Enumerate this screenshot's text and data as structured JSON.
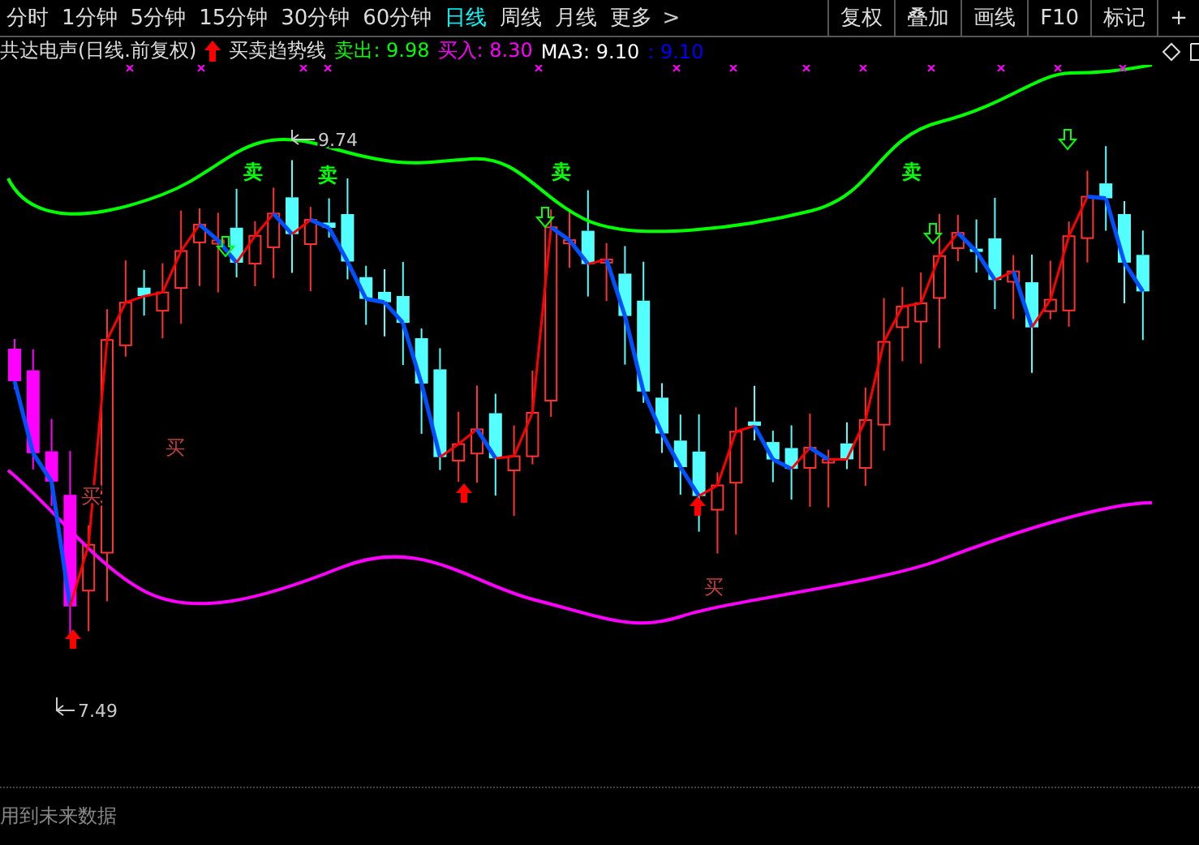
{
  "toolbar": {
    "periods": [
      {
        "label": "分时",
        "selected": false
      },
      {
        "label": "1分钟",
        "selected": false
      },
      {
        "label": "5分钟",
        "selected": false
      },
      {
        "label": "15分钟",
        "selected": false
      },
      {
        "label": "30分钟",
        "selected": false
      },
      {
        "label": "60分钟",
        "selected": false
      },
      {
        "label": "日线",
        "selected": true
      },
      {
        "label": "周线",
        "selected": false
      },
      {
        "label": "月线",
        "selected": false
      },
      {
        "label": "更多",
        "selected": false
      }
    ],
    "more_arrow": ">",
    "buttons": [
      "复权",
      "叠加",
      "画线",
      "F10",
      "标记",
      "+"
    ]
  },
  "legend": {
    "title": "共达电声(日线.前复权)",
    "indicator": "买卖趋势线",
    "items": [
      {
        "text": "卖出: 9.98",
        "color": "#00ff00"
      },
      {
        "text": "买入: 8.30",
        "color": "#ff00ff"
      },
      {
        "text": "MA3: 9.10",
        "color": "#ffffff"
      },
      {
        "text": ": 9.10",
        "color": "#0000ff"
      }
    ]
  },
  "chart": {
    "max_label": "9.74",
    "min_label": "7.49",
    "signals": [
      {
        "kind": "sell",
        "text": "卖"
      },
      {
        "kind": "sell",
        "text": "卖"
      },
      {
        "kind": "sell",
        "text": "卖"
      },
      {
        "kind": "sell",
        "text": "卖"
      },
      {
        "kind": "buy",
        "text": "买"
      },
      {
        "kind": "buy",
        "text": "买"
      },
      {
        "kind": "buy",
        "text": "买"
      }
    ]
  },
  "footer": {
    "note": "用到未来数据"
  }
}
